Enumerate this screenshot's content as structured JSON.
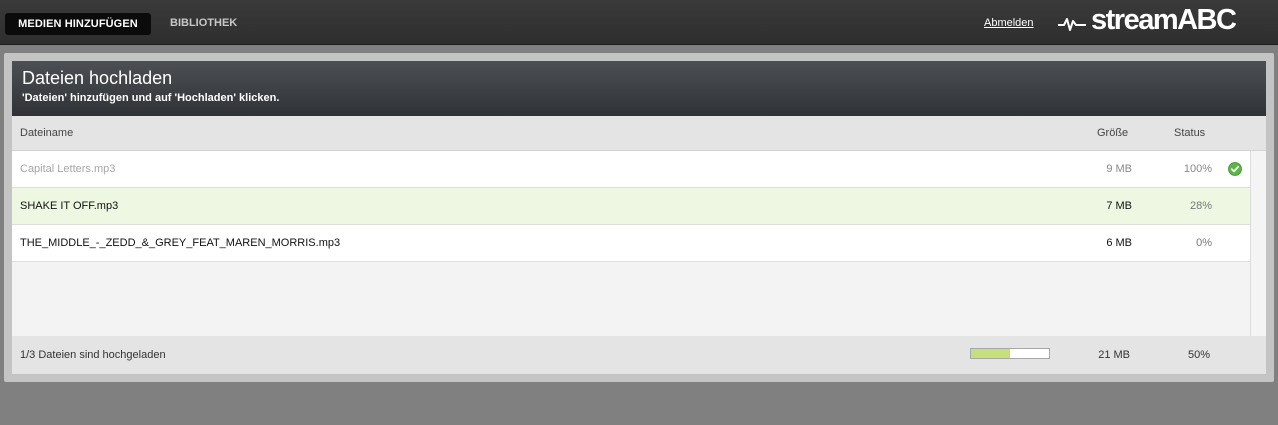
{
  "nav": {
    "tab_active": "MEDIEN HINZUFÜGEN",
    "tab_library": "BIBLIOTHEK",
    "logout": "Abmelden",
    "logo": "streamABC"
  },
  "panel": {
    "title": "Dateien hochladen",
    "subtitle": "'Dateien' hinzufügen und auf 'Hochladen' klicken."
  },
  "table": {
    "headers": {
      "name": "Dateiname",
      "size": "Größe",
      "status": "Status"
    },
    "rows": [
      {
        "name": "Capital Letters.mp3",
        "size": "9 MB",
        "status": "100%",
        "state": "done"
      },
      {
        "name": "SHAKE IT OFF.mp3",
        "size": "7 MB",
        "status": "28%",
        "state": "uploading"
      },
      {
        "name": "THE_MIDDLE_-_ZEDD_&_GREY_FEAT_MAREN_MORRIS.mp3",
        "size": "6 MB",
        "status": "0%",
        "state": "pending"
      }
    ]
  },
  "footer": {
    "summary": "1/3 Dateien sind hochgeladen",
    "total_size": "21 MB",
    "total_status": "50%",
    "progress_fraction": 0.5
  },
  "colors": {
    "progress_fill": "#c4e07c",
    "check_green": "#5cb544",
    "active_row": "#eef7e2"
  }
}
